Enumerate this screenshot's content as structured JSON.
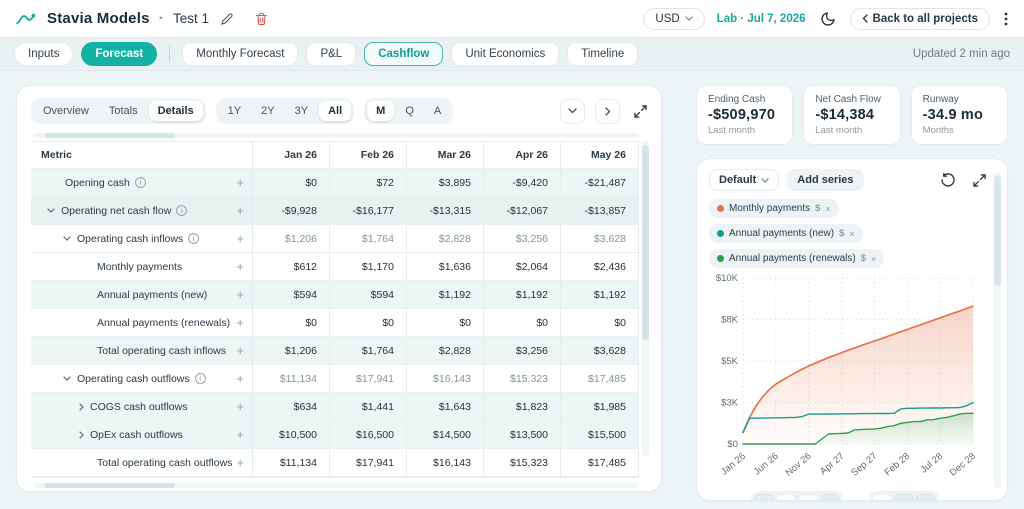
{
  "header": {
    "app_title": "Stavia Models",
    "dot": "·",
    "project_name": "Test 1",
    "currency_selector": "USD",
    "plan_date": "Lab · Jul 7, 2026",
    "back_button_label": "Back to all projects"
  },
  "tab_bar": {
    "primary_tabs": [
      {
        "label": "Inputs",
        "active": false
      },
      {
        "label": "Forecast",
        "active": true
      }
    ],
    "secondary_tabs": [
      {
        "label": "Monthly Forecast",
        "active": false
      },
      {
        "label": "P&L",
        "active": false
      },
      {
        "label": "Cashflow",
        "active": true
      },
      {
        "label": "Unit Economics",
        "active": false
      },
      {
        "label": "Timeline",
        "active": false
      }
    ],
    "updated_text": "Updated 2 min ago"
  },
  "table_panel": {
    "view_modes": [
      {
        "label": "Overview",
        "active": false
      },
      {
        "label": "Totals",
        "active": false
      },
      {
        "label": "Details",
        "active": true
      }
    ],
    "range_options": [
      {
        "label": "1Y",
        "active": false
      },
      {
        "label": "2Y",
        "active": false
      },
      {
        "label": "3Y",
        "active": false
      },
      {
        "label": "All",
        "active": true
      }
    ],
    "granularity_options": [
      {
        "label": "M",
        "active": true
      },
      {
        "label": "Q",
        "active": false
      },
      {
        "label": "A",
        "active": false
      }
    ],
    "columns": [
      "Metric",
      "Jan 26",
      "Feb 26",
      "Mar 26",
      "Apr 26",
      "May 26"
    ],
    "rows": [
      {
        "label": "Opening cash",
        "indent": 1,
        "info": true,
        "chevron": null,
        "tint": true,
        "muted": false,
        "values": [
          "$0",
          "$72",
          "$3,895",
          "-$9,420",
          "-$21,487"
        ]
      },
      {
        "label": "Operating net cash flow",
        "indent": 1,
        "info": true,
        "chevron": "down",
        "tint": true,
        "muted": false,
        "values": [
          "-$9,928",
          "-$16,177",
          "-$13,315",
          "-$12,067",
          "-$13,857"
        ]
      },
      {
        "label": "Operating cash inflows",
        "indent": 2,
        "info": true,
        "chevron": "down",
        "tint": false,
        "muted": true,
        "values": [
          "$1,206",
          "$1,764",
          "$2,828",
          "$3,256",
          "$3,628"
        ]
      },
      {
        "label": "Monthly payments",
        "indent": 3,
        "info": false,
        "chevron": null,
        "tint": false,
        "muted": false,
        "values": [
          "$612",
          "$1,170",
          "$1,636",
          "$2,064",
          "$2,436"
        ]
      },
      {
        "label": "Annual payments (new)",
        "indent": 3,
        "info": false,
        "chevron": null,
        "tint": true,
        "muted": false,
        "values": [
          "$594",
          "$594",
          "$1,192",
          "$1,192",
          "$1,192"
        ]
      },
      {
        "label": "Annual payments (renewals)",
        "indent": 3,
        "info": false,
        "chevron": null,
        "tint": false,
        "muted": false,
        "values": [
          "$0",
          "$0",
          "$0",
          "$0",
          "$0"
        ]
      },
      {
        "label": "Total operating cash inflows",
        "indent": 3,
        "info": false,
        "chevron": null,
        "tint": true,
        "muted": false,
        "values": [
          "$1,206",
          "$1,764",
          "$2,828",
          "$3,256",
          "$3,628"
        ]
      },
      {
        "label": "Operating cash outflows",
        "indent": 2,
        "info": true,
        "chevron": "down",
        "tint": false,
        "muted": true,
        "values": [
          "$11,134",
          "$17,941",
          "$16,143",
          "$15,323",
          "$17,485"
        ]
      },
      {
        "label": "COGS cash outflows",
        "indent": 3,
        "info": false,
        "chevron": "right",
        "tint": true,
        "muted": false,
        "values": [
          "$634",
          "$1,441",
          "$1,643",
          "$1,823",
          "$1,985"
        ]
      },
      {
        "label": "OpEx cash outflows",
        "indent": 3,
        "info": false,
        "chevron": "right",
        "tint": true,
        "muted": false,
        "values": [
          "$10,500",
          "$16,500",
          "$14,500",
          "$13,500",
          "$15,500"
        ]
      },
      {
        "label": "Total operating cash outflows",
        "indent": 3,
        "info": false,
        "chevron": null,
        "tint": false,
        "muted": false,
        "values": [
          "$11,134",
          "$17,941",
          "$16,143",
          "$15,323",
          "$17,485"
        ]
      }
    ]
  },
  "kpis": [
    {
      "title": "Ending Cash",
      "value": "-$509,970",
      "subtitle": "Last month"
    },
    {
      "title": "Net Cash Flow",
      "value": "-$14,384",
      "subtitle": "Last month"
    },
    {
      "title": "Runway",
      "value": "-34.9 mo",
      "subtitle": "Months"
    }
  ],
  "chart_panel": {
    "preset_label": "Default",
    "add_series_label": "Add series",
    "legend": [
      {
        "label": "Monthly payments",
        "unit": "$",
        "color": "#e8734a"
      },
      {
        "label": "Annual payments (new)",
        "unit": "$",
        "color": "#159e90"
      },
      {
        "label": "Annual payments (renewals)",
        "unit": "$",
        "color": "#2ba04d"
      }
    ]
  },
  "chart_data": {
    "type": "line",
    "title": "",
    "xlabel": "",
    "ylabel": "",
    "x_range_months": 36,
    "ylim": [
      0,
      10000
    ],
    "grid": "dotted",
    "legend_position": "top",
    "y_ticks": [
      {
        "value": 0,
        "label": "$0"
      },
      {
        "value": 2500,
        "label": "$3K"
      },
      {
        "value": 5000,
        "label": "$5K"
      },
      {
        "value": 7500,
        "label": "$8K"
      },
      {
        "value": 10000,
        "label": "$10K"
      }
    ],
    "x_ticks": [
      {
        "index": 0,
        "label": "Jan 26"
      },
      {
        "index": 5,
        "label": "Jun 26"
      },
      {
        "index": 10,
        "label": "Nov 26"
      },
      {
        "index": 15,
        "label": "Apr 27"
      },
      {
        "index": 20,
        "label": "Sep 27"
      },
      {
        "index": 25,
        "label": "Feb 28"
      },
      {
        "index": 30,
        "label": "Jul 28"
      },
      {
        "index": 35,
        "label": "Dec 28"
      }
    ],
    "series": [
      {
        "name": "Monthly payments",
        "color": "#e8734a",
        "fill": true,
        "values": [
          700,
          1600,
          2300,
          2850,
          3280,
          3600,
          3850,
          4080,
          4300,
          4510,
          4700,
          4870,
          5040,
          5200,
          5350,
          5500,
          5650,
          5790,
          5930,
          6070,
          6200,
          6340,
          6480,
          6620,
          6760,
          6900,
          7040,
          7180,
          7320,
          7460,
          7600,
          7740,
          7880,
          8020,
          8160,
          8300
        ]
      },
      {
        "name": "Annual payments (new)",
        "color": "#159e90",
        "fill": false,
        "values": [
          700,
          1550,
          1560,
          1560,
          1570,
          1580,
          1580,
          1590,
          1600,
          1650,
          1800,
          1800,
          1800,
          1810,
          1810,
          1820,
          1820,
          1820,
          1830,
          1830,
          1830,
          1840,
          1840,
          1850,
          2100,
          2150,
          2150,
          2160,
          2160,
          2170,
          2170,
          2180,
          2180,
          2190,
          2300,
          2500
        ]
      },
      {
        "name": "Annual payments (renewals)",
        "color": "#2ba04d",
        "fill": true,
        "values": [
          0,
          0,
          0,
          0,
          0,
          0,
          0,
          0,
          0,
          0,
          0,
          0,
          300,
          600,
          620,
          640,
          660,
          850,
          870,
          890,
          900,
          950,
          1050,
          1100,
          1250,
          1300,
          1350,
          1350,
          1450,
          1470,
          1550,
          1600,
          1700,
          1800,
          1850,
          1850
        ]
      }
    ]
  }
}
